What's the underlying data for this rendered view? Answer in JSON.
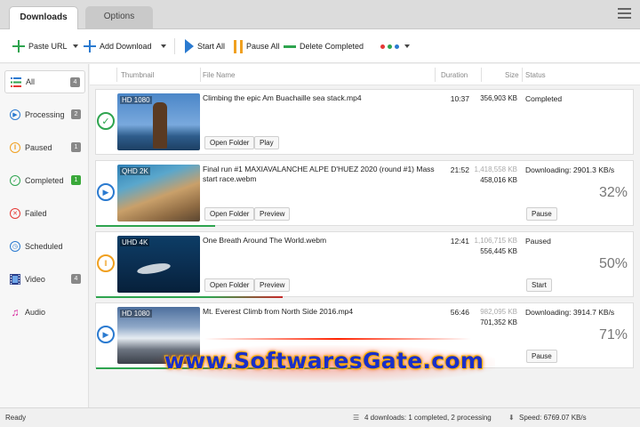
{
  "tabs": [
    {
      "label": "Downloads",
      "active": true
    },
    {
      "label": "Options",
      "active": false
    }
  ],
  "toolbar": {
    "paste_url": "Paste URL",
    "add_download": "Add Download",
    "start_all": "Start All",
    "pause_all": "Pause All",
    "delete_completed": "Delete Completed"
  },
  "sidebar": {
    "items": [
      {
        "label": "All",
        "count": "4",
        "icon": "list-icon"
      },
      {
        "label": "Processing",
        "count": "2",
        "icon": "play-circle-icon"
      },
      {
        "label": "Paused",
        "count": "1",
        "icon": "pause-circle-icon"
      },
      {
        "label": "Completed",
        "count": "1",
        "icon": "check-circle-icon"
      },
      {
        "label": "Failed",
        "count": "",
        "icon": "x-circle-icon"
      },
      {
        "label": "Scheduled",
        "count": "",
        "icon": "clock-icon"
      },
      {
        "label": "Video",
        "count": "4",
        "icon": "film-icon"
      },
      {
        "label": "Audio",
        "count": "",
        "icon": "music-icon"
      }
    ]
  },
  "columns": {
    "thumbnail": "Thumbnail",
    "file_name": "File Name",
    "duration": "Duration",
    "size": "Size",
    "status": "Status"
  },
  "downloads": [
    {
      "quality": "HD 1080",
      "file_name": "Climbing the epic Am Buachaille sea stack.mp4",
      "duration": "10:37",
      "size_total": "356,903 KB",
      "status": "Completed",
      "percent": "",
      "progress": 1.0,
      "button1": "Open Folder",
      "button2": "Play",
      "action": ""
    },
    {
      "quality": "QHD 2K",
      "file_name": "Final run #1 MAXIAVALANCHE ALPE D'HUEZ 2020 (round #1) Mass start race.webm",
      "duration": "21:52",
      "size_total": "1,418,558 KB",
      "size_done": "458,016 KB",
      "status": "Downloading: 2901.3 KB/s",
      "percent": "32%",
      "progress": 0.32,
      "button1": "Open Folder",
      "button2": "Preview",
      "action": "Pause"
    },
    {
      "quality": "UHD 4K",
      "file_name": "One Breath Around The World.webm",
      "duration": "12:41",
      "size_total": "1,106,715 KB",
      "size_done": "556,445 KB",
      "status": "Paused",
      "percent": "50%",
      "progress": 0.5,
      "button1": "Open Folder",
      "button2": "Preview",
      "action": "Start"
    },
    {
      "quality": "HD 1080",
      "file_name": "Mt. Everest Climb from North Side 2016.mp4",
      "duration": "56:46",
      "size_total": "982,095 KB",
      "size_done": "701,352 KB",
      "status": "Downloading: 3914.7 KB/s",
      "percent": "71%",
      "progress": 0.71,
      "button1": "Open Folder",
      "button2": "Preview",
      "action": "Pause"
    }
  ],
  "watermark": "www.SoftwaresGate.com",
  "statusbar": {
    "ready": "Ready",
    "summary": "4 downloads: 1 completed, 2 processing",
    "speed": "Speed: 6769.07 KB/s"
  },
  "colors": {
    "accent_blue": "#2a7ad0",
    "green": "#2ea44f",
    "orange": "#f0a020",
    "red": "#e53935"
  }
}
